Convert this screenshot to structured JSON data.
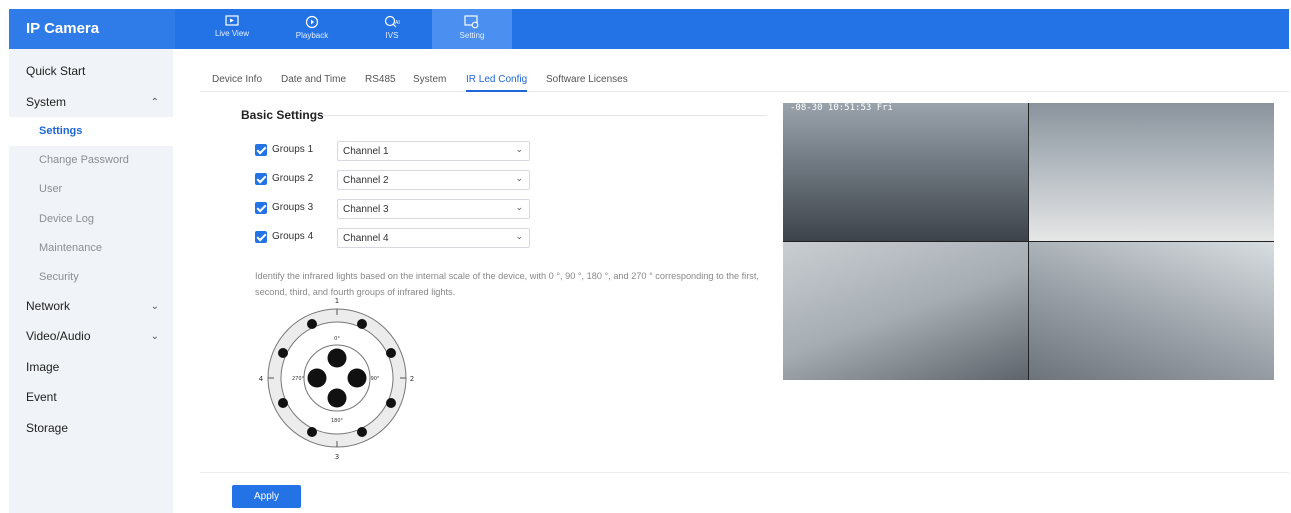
{
  "app": {
    "title": "IP Camera"
  },
  "topnav": [
    {
      "label": "Live View",
      "icon": "live-view-icon"
    },
    {
      "label": "Playback",
      "icon": "playback-icon"
    },
    {
      "label": "IVS",
      "icon": "ivs-icon"
    },
    {
      "label": "Setting",
      "icon": "setting-icon",
      "active": true
    }
  ],
  "sidebar": {
    "quick_start": "Quick Start",
    "system": "System",
    "settings": "Settings",
    "change_password": "Change Password",
    "user": "User",
    "device_log": "Device Log",
    "maintenance": "Maintenance",
    "security": "Security",
    "network": "Network",
    "video_audio": "Video/Audio",
    "image": "Image",
    "event": "Event",
    "storage": "Storage"
  },
  "tabs": [
    "Device Info",
    "Date and Time",
    "RS485",
    "System",
    "IR Led Config",
    "Software Licenses"
  ],
  "active_tab": "IR Led Config",
  "basic": {
    "title": "Basic Settings",
    "groups": [
      {
        "label": "Groups 1",
        "checked": true,
        "channel": "Channel 1"
      },
      {
        "label": "Groups 2",
        "checked": true,
        "channel": "Channel 2"
      },
      {
        "label": "Groups 3",
        "checked": true,
        "channel": "Channel 3"
      },
      {
        "label": "Groups 4",
        "checked": true,
        "channel": "Channel 4"
      }
    ],
    "description": "Identify the infrared lights based on the internal scale of the device, with 0 °, 90 °, 180 °, and 270 ° corresponding to the first, second, third, and fourth groups of infrared lights."
  },
  "diagram": {
    "outer_labels": {
      "top": "1",
      "right": "2",
      "bottom": "3",
      "left": "4"
    },
    "inner_labels": {
      "top": "0°",
      "right": "90°",
      "bottom": "180°",
      "left": "270°"
    }
  },
  "video": {
    "osd": "-08-30 10:51:53 Fri"
  },
  "actions": {
    "apply": "Apply"
  },
  "colors": {
    "primary": "#2473e6",
    "sidebar_bg": "#f0f3f7"
  }
}
